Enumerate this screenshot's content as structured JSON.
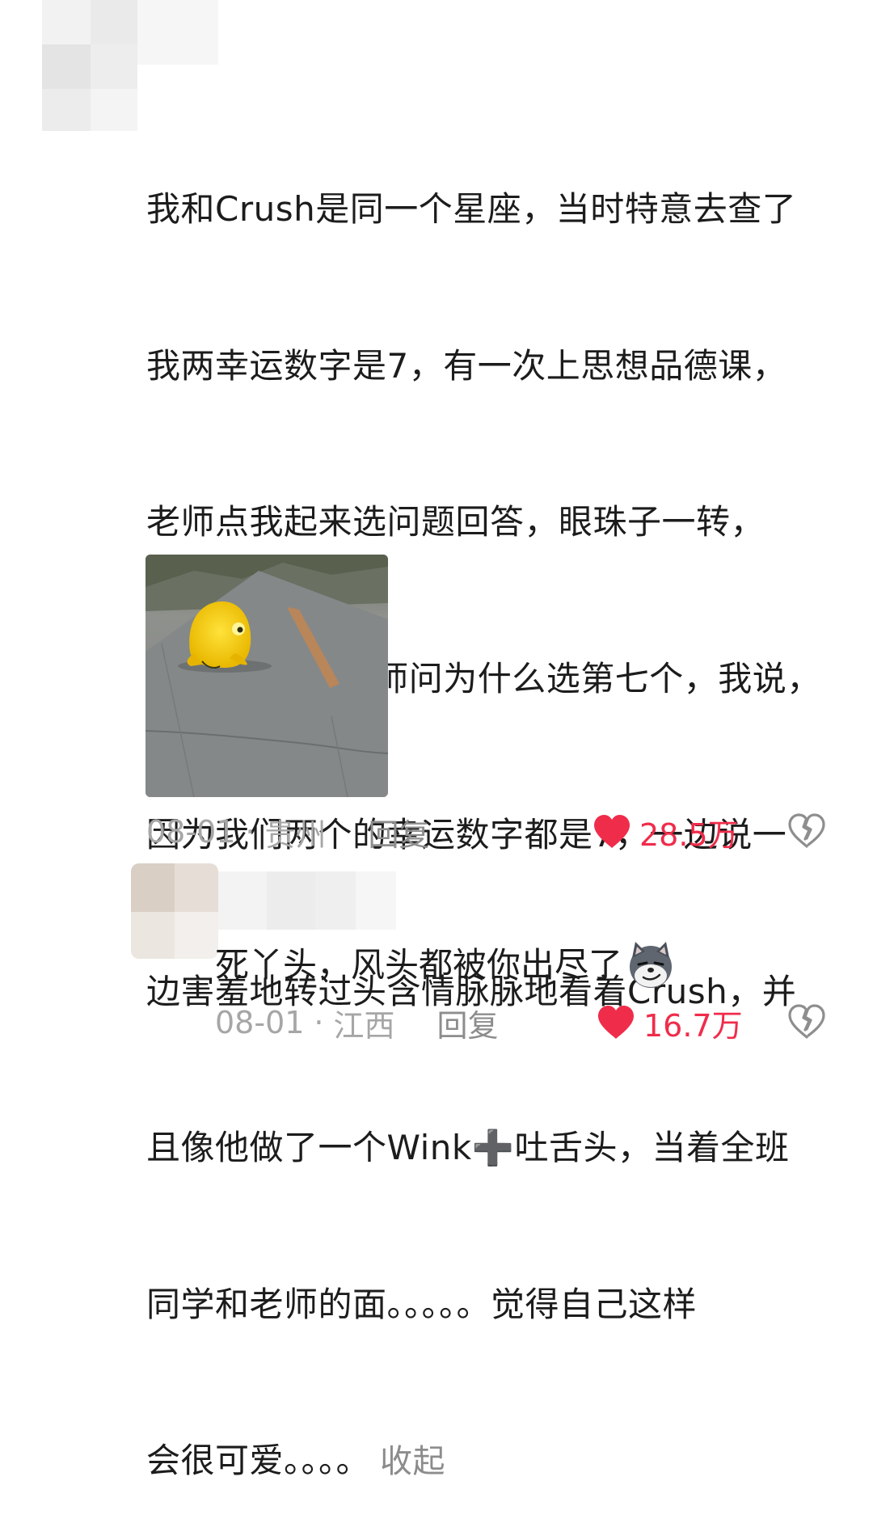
{
  "comment": {
    "lines": [
      "我和Crush是同一个星座，当时特意去查了",
      "我两幸运数字是7，有一次上思想品德课，",
      "老师点我起来选问题回答，眼珠子一转，",
      "我说我选7，老师问为什么选第七个，我说，",
      "因为我们两个的幸运数字都是7，一边说一",
      "边害羞地转过头含情脉脉地看着Crush，并",
      "且像他做了一个Wink➕吐舌头，当着全班",
      "同学和老师的面。。。。。觉得自己这样",
      "会很可爱。。。。"
    ],
    "collapse_label": "收起",
    "image_icon": "yellow-frog-sticker",
    "date": "08-01",
    "separator": "·",
    "location": "贵州",
    "reply_label": "回复",
    "like_count": "28.5万",
    "liked": true
  },
  "reply": {
    "text": "死丫头，风头都被你出尽了",
    "emoji_icon": "husky-smirk-emoji",
    "date": "08-01",
    "separator": "·",
    "location": "江西",
    "reply_label": "回复",
    "like_count": "16.7万",
    "liked": true
  },
  "colors": {
    "like_red": "#f02c4b",
    "meta_gray": "#a6a6a6"
  }
}
